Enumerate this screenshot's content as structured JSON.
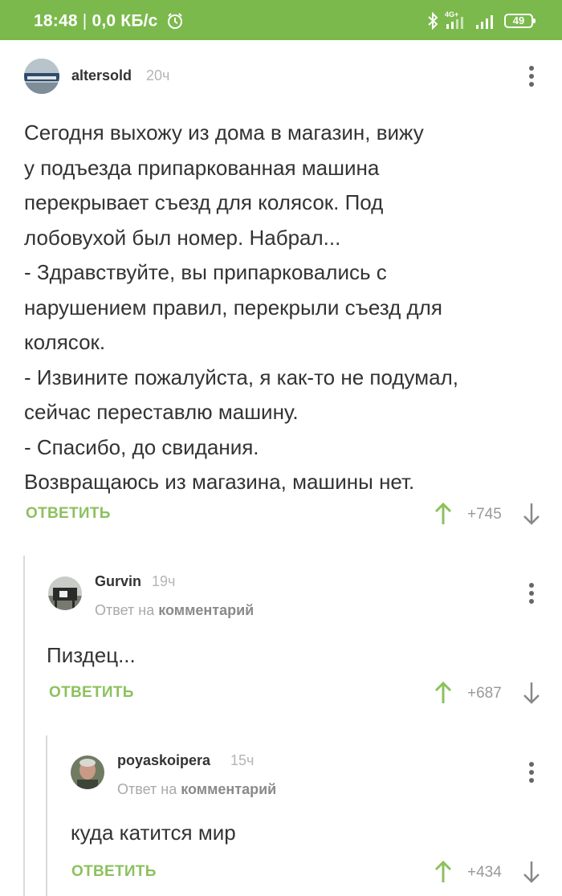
{
  "status_bar": {
    "time": "18:48",
    "separator": "|",
    "speed": "0,0 КБ/с",
    "network": "4G+",
    "battery": "49"
  },
  "comments": [
    {
      "username": "altersold",
      "time": "20ч",
      "text": "Сегодня выхожу из дома в магазин, вижу\nу подъезда припаркованная машина\nперекрывает съезд для колясок. Под\nлобовухой был номер. Набрал...\n- Здравствуйте, вы припарковались с\nнарушением правил, перекрыли съезд для\nколясок.\n- Извините пожалуйста, я как-то не подумал,\nсейчас переставлю машину.\n- Спасибо, до свидания.\nВозвращаюсь из магазина, машины нет.",
      "reply_label": "ОТВЕТИТЬ",
      "votes": "+745"
    },
    {
      "username": "Gurvin",
      "time": "19ч",
      "reply_prefix": "Ответ на",
      "reply_target": "комментарий",
      "text": "Пиздец...",
      "reply_label": "ОТВЕТИТЬ",
      "votes": "+687"
    },
    {
      "username": "poyaskoipera",
      "time": "15ч",
      "reply_prefix": "Ответ на",
      "reply_target": "комментарий",
      "text": "куда катится мир",
      "reply_label": "ОТВЕТИТЬ",
      "votes": "+434"
    }
  ],
  "icons": [
    "alarm-clock-icon",
    "bluetooth-icon",
    "signal-icon",
    "battery-icon",
    "more-vertical-icon",
    "arrow-up-icon",
    "arrow-down-icon"
  ],
  "colors": {
    "status_bar": "#7bb94c",
    "accent_green": "#8cc15e",
    "text": "#333333",
    "muted": "#a9a9a9"
  }
}
